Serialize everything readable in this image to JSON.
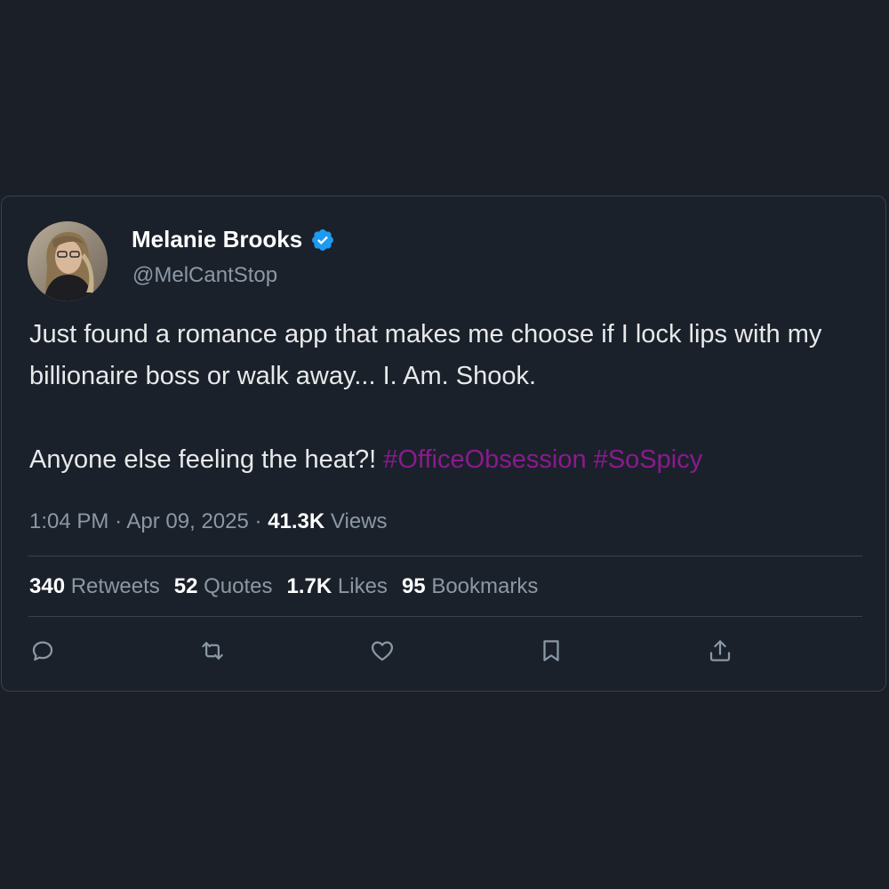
{
  "tweet": {
    "author": {
      "display_name": "Melanie Brooks",
      "handle": "@MelCantStop",
      "verified": true,
      "verified_color": "#1d9bf0"
    },
    "text_line1": "Just found a romance app that makes me choose if I lock lips with my billionaire boss or walk away... I. Am. Shook.",
    "text_line2_prefix": "Anyone else feeling the heat?! ",
    "hashtags": [
      "#OfficeObsession",
      "#SoSpicy"
    ],
    "hashtag_color": "#8b1a8e",
    "time": "1:04 PM",
    "date": "Apr 09, 2025",
    "views_count": "41.3K",
    "views_label": "Views",
    "stats": {
      "retweets_count": "340",
      "retweets_label": "Retweets",
      "quotes_count": "52",
      "quotes_label": "Quotes",
      "likes_count": "1.7K",
      "likes_label": "Likes",
      "bookmarks_count": "95",
      "bookmarks_label": "Bookmarks"
    },
    "actions": [
      "reply-icon",
      "retweet-icon",
      "like-icon",
      "bookmark-icon",
      "share-icon"
    ]
  },
  "colors": {
    "background": "#1a1f28",
    "card": "#1b212b",
    "text": "#e7e9ea",
    "muted": "#8b98a5"
  }
}
